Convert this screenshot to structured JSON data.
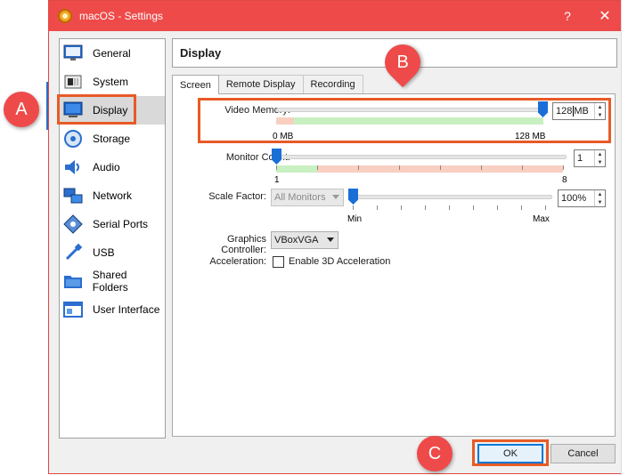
{
  "window": {
    "title": "macOS - Settings",
    "help_glyph": "?",
    "close_glyph": "✕"
  },
  "sidebar": {
    "items": [
      {
        "label": "General",
        "icon": "general-icon"
      },
      {
        "label": "System",
        "icon": "system-icon"
      },
      {
        "label": "Display",
        "icon": "display-icon",
        "selected": true
      },
      {
        "label": "Storage",
        "icon": "storage-icon"
      },
      {
        "label": "Audio",
        "icon": "audio-icon"
      },
      {
        "label": "Network",
        "icon": "network-icon"
      },
      {
        "label": "Serial Ports",
        "icon": "serial-ports-icon"
      },
      {
        "label": "USB",
        "icon": "usb-icon"
      },
      {
        "label": "Shared Folders",
        "icon": "shared-folders-icon"
      },
      {
        "label": "User Interface",
        "icon": "user-interface-icon"
      }
    ]
  },
  "page": {
    "title": "Display",
    "tabs": [
      {
        "label": "Screen",
        "active": true
      },
      {
        "label": "Remote Display"
      },
      {
        "label": "Recording"
      }
    ]
  },
  "screen": {
    "video_memory": {
      "label": "Video Memory:",
      "value": "128",
      "unit": "MB",
      "min_label": "0 MB",
      "max_label": "128 MB",
      "level": 1.0
    },
    "monitor_count": {
      "label": "Monitor Count:",
      "value": "1",
      "min_label": "1",
      "max_label": "8",
      "level": 0.0
    },
    "scale_factor": {
      "label": "Scale Factor:",
      "monitor_select": "All Monitors",
      "value": "100%",
      "min_label": "Min",
      "max_label": "Max",
      "level": 0.0
    },
    "graphics_controller": {
      "label": "Graphics Controller:",
      "value": "VBoxVGA"
    },
    "acceleration": {
      "label": "Acceleration:",
      "checkbox_label": "Enable 3D Acceleration",
      "checked": false
    }
  },
  "footer": {
    "ok_label": "OK",
    "cancel_label": "Cancel"
  },
  "annotations": {
    "a": "A",
    "b": "B",
    "c": "C"
  },
  "colors": {
    "titlebar": "#ee4a4a",
    "highlight": "#e85a26",
    "accent": "#1a6fd6"
  }
}
